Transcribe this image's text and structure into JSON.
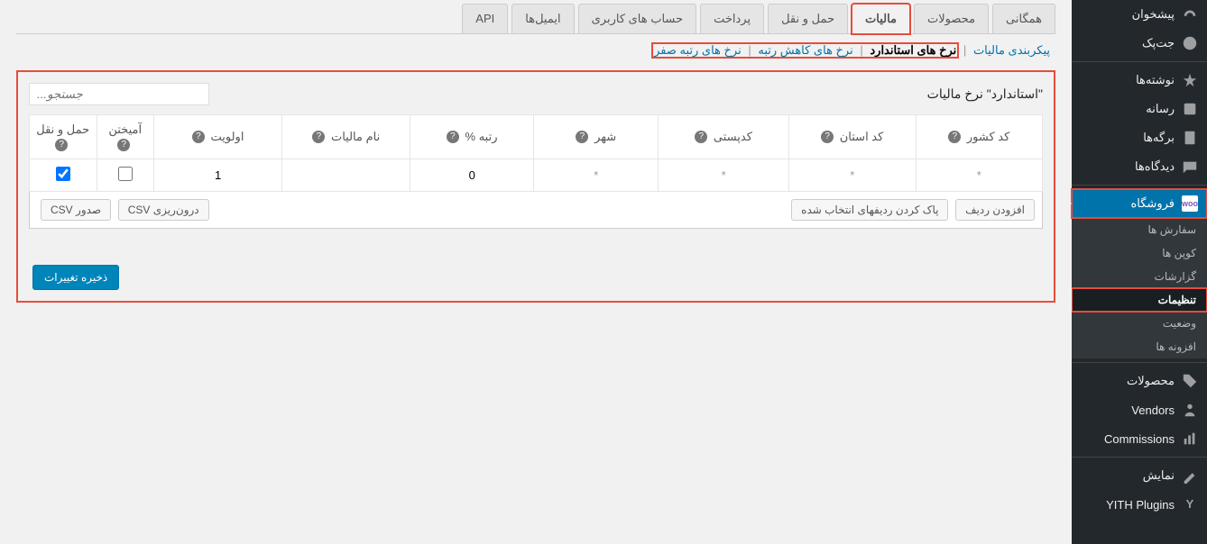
{
  "sidebar": {
    "top": [
      {
        "label": "پیشخوان",
        "icon": "dashboard"
      },
      {
        "label": "جت‌پک",
        "icon": "jetpack"
      }
    ],
    "mid": [
      {
        "label": "نوشته‌ها",
        "icon": "pin"
      },
      {
        "label": "رسانه",
        "icon": "media"
      },
      {
        "label": "برگه‌ها",
        "icon": "pages"
      },
      {
        "label": "دیدگاه‌ها",
        "icon": "comments"
      }
    ],
    "shop": {
      "label": "فروشگاه",
      "icon": "woo"
    },
    "shop_subs": [
      {
        "label": "سفارش ها"
      },
      {
        "label": "کوپن ها"
      },
      {
        "label": "گزارشات"
      },
      {
        "label": "تنظیمات",
        "active": true
      },
      {
        "label": "وضعیت"
      },
      {
        "label": "افزونه ها"
      }
    ],
    "bottom": [
      {
        "label": "محصولات",
        "icon": "products"
      },
      {
        "label": "Vendors",
        "icon": "vendors"
      },
      {
        "label": "Commissions",
        "icon": "commissions"
      },
      {
        "label": "نمایش",
        "icon": "appearance"
      },
      {
        "label": "YITH Plugins",
        "icon": "yith"
      }
    ]
  },
  "tabs": [
    {
      "label": "همگانی"
    },
    {
      "label": "محصولات"
    },
    {
      "label": "مالیات",
      "active": true
    },
    {
      "label": "حمل و نقل"
    },
    {
      "label": "پرداخت"
    },
    {
      "label": "حساب های کاربری"
    },
    {
      "label": "ایمیل‌ها"
    },
    {
      "label": "API"
    }
  ],
  "subtabs": [
    {
      "label": "پیکربندی مالیات",
      "active": false,
      "last": false
    },
    {
      "label": "نرخ های استاندارد",
      "active": true,
      "last": false
    },
    {
      "label": "نرخ های کاهش رتبه",
      "active": false,
      "last": false
    },
    {
      "label": "نرخ های رتبه صفر",
      "active": false,
      "last": true
    }
  ],
  "section": {
    "title": "\"استاندارد\" نرخ مالیات",
    "search_placeholder": "جستجو..."
  },
  "table": {
    "headers": [
      "کد  کشور",
      "کد استان",
      "کدپستی",
      "شهر",
      "رتبه %",
      "نام مالیات",
      "اولویت",
      "آمیختن",
      "حمل و نقل"
    ],
    "row": {
      "country": "*",
      "state": "*",
      "postcode": "*",
      "city": "*",
      "rate": "0",
      "name": "",
      "priority": "1",
      "compound": false,
      "shipping": true
    }
  },
  "buttons": {
    "add_row": "افزودن ردیف",
    "remove_rows": "پاک کردن ردیفهای انتخاب شده",
    "import_csv": "درون‌ریزی CSV",
    "export_csv": "صدور CSV",
    "save": "ذخیره تغییرات"
  }
}
